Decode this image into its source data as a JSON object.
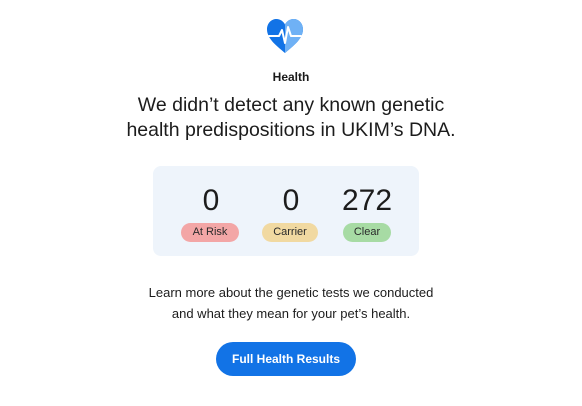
{
  "header": {
    "icon": "heart-pulse-icon",
    "label": "Health"
  },
  "headline": {
    "line1": "We didn’t detect any known genetic",
    "line2": "health predispositions in UKIM’s DNA."
  },
  "stats": [
    {
      "value": "0",
      "label": "At Risk",
      "color": "#f3a6a6"
    },
    {
      "value": "0",
      "label": "Carrier",
      "color": "#f1d9a1"
    },
    {
      "value": "272",
      "label": "Clear",
      "color": "#a7dba4"
    }
  ],
  "learn_more": {
    "line1": "Learn more about the genetic tests we conducted",
    "line2": "and what they mean for your pet’s health."
  },
  "cta": {
    "label": "Full Health Results",
    "color": "#1273e6"
  },
  "colors": {
    "accent": "#1273e6",
    "heart_light": "#6fb1f5",
    "card_bg": "#eef4fb"
  }
}
